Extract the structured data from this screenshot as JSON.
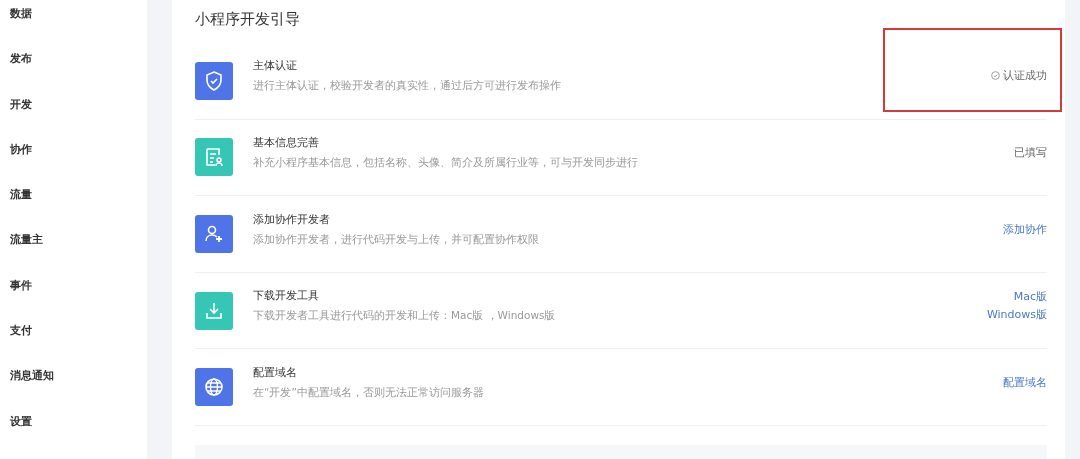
{
  "sidebar": {
    "items": [
      {
        "label": "数据"
      },
      {
        "label": "发布"
      },
      {
        "label": "开发"
      },
      {
        "label": "协作"
      },
      {
        "label": "流量"
      },
      {
        "label": "流量主"
      },
      {
        "label": "事件"
      },
      {
        "label": "支付"
      },
      {
        "label": "消息通知"
      },
      {
        "label": "设置"
      }
    ]
  },
  "panel": {
    "title": "小程序开发引导",
    "steps": [
      {
        "kind": "shield",
        "color": "#4f74e8",
        "title": "主体认证",
        "description": "进行主体认证，校验开发者的真实性，通过后方可进行发布操作",
        "highlighted": true,
        "actions": [
          {
            "kind": "status",
            "label": "认证成功"
          }
        ]
      },
      {
        "kind": "form",
        "color": "#35c6b6",
        "title": "基本信息完善",
        "description": "补充小程序基本信息，包括名称、头像、简介及所属行业等，可与开发同步进行",
        "highlighted": false,
        "actions": [
          {
            "kind": "text",
            "label": "已填写"
          }
        ]
      },
      {
        "kind": "people",
        "color": "#4f74e8",
        "title": "添加协作开发者",
        "description": "添加协作开发者，进行代码开发与上传，并可配置协作权限",
        "highlighted": false,
        "actions": [
          {
            "kind": "link",
            "label": "添加协作"
          }
        ]
      },
      {
        "kind": "download",
        "color": "#35c6b6",
        "title": "下载开发工具",
        "description": "下载开发者工具进行代码的开发和上传：Mac版 ，Windows版",
        "highlighted": false,
        "actions": [
          {
            "kind": "link",
            "label": "Mac版"
          },
          {
            "kind": "link",
            "label": "Windows版"
          }
        ]
      },
      {
        "kind": "globe",
        "color": "#4f74e8",
        "title": "配置域名",
        "description": "在“开发”中配置域名，否则无法正常访问服务器",
        "highlighted": false,
        "actions": [
          {
            "kind": "link",
            "label": "配置域名"
          }
        ]
      }
    ]
  }
}
